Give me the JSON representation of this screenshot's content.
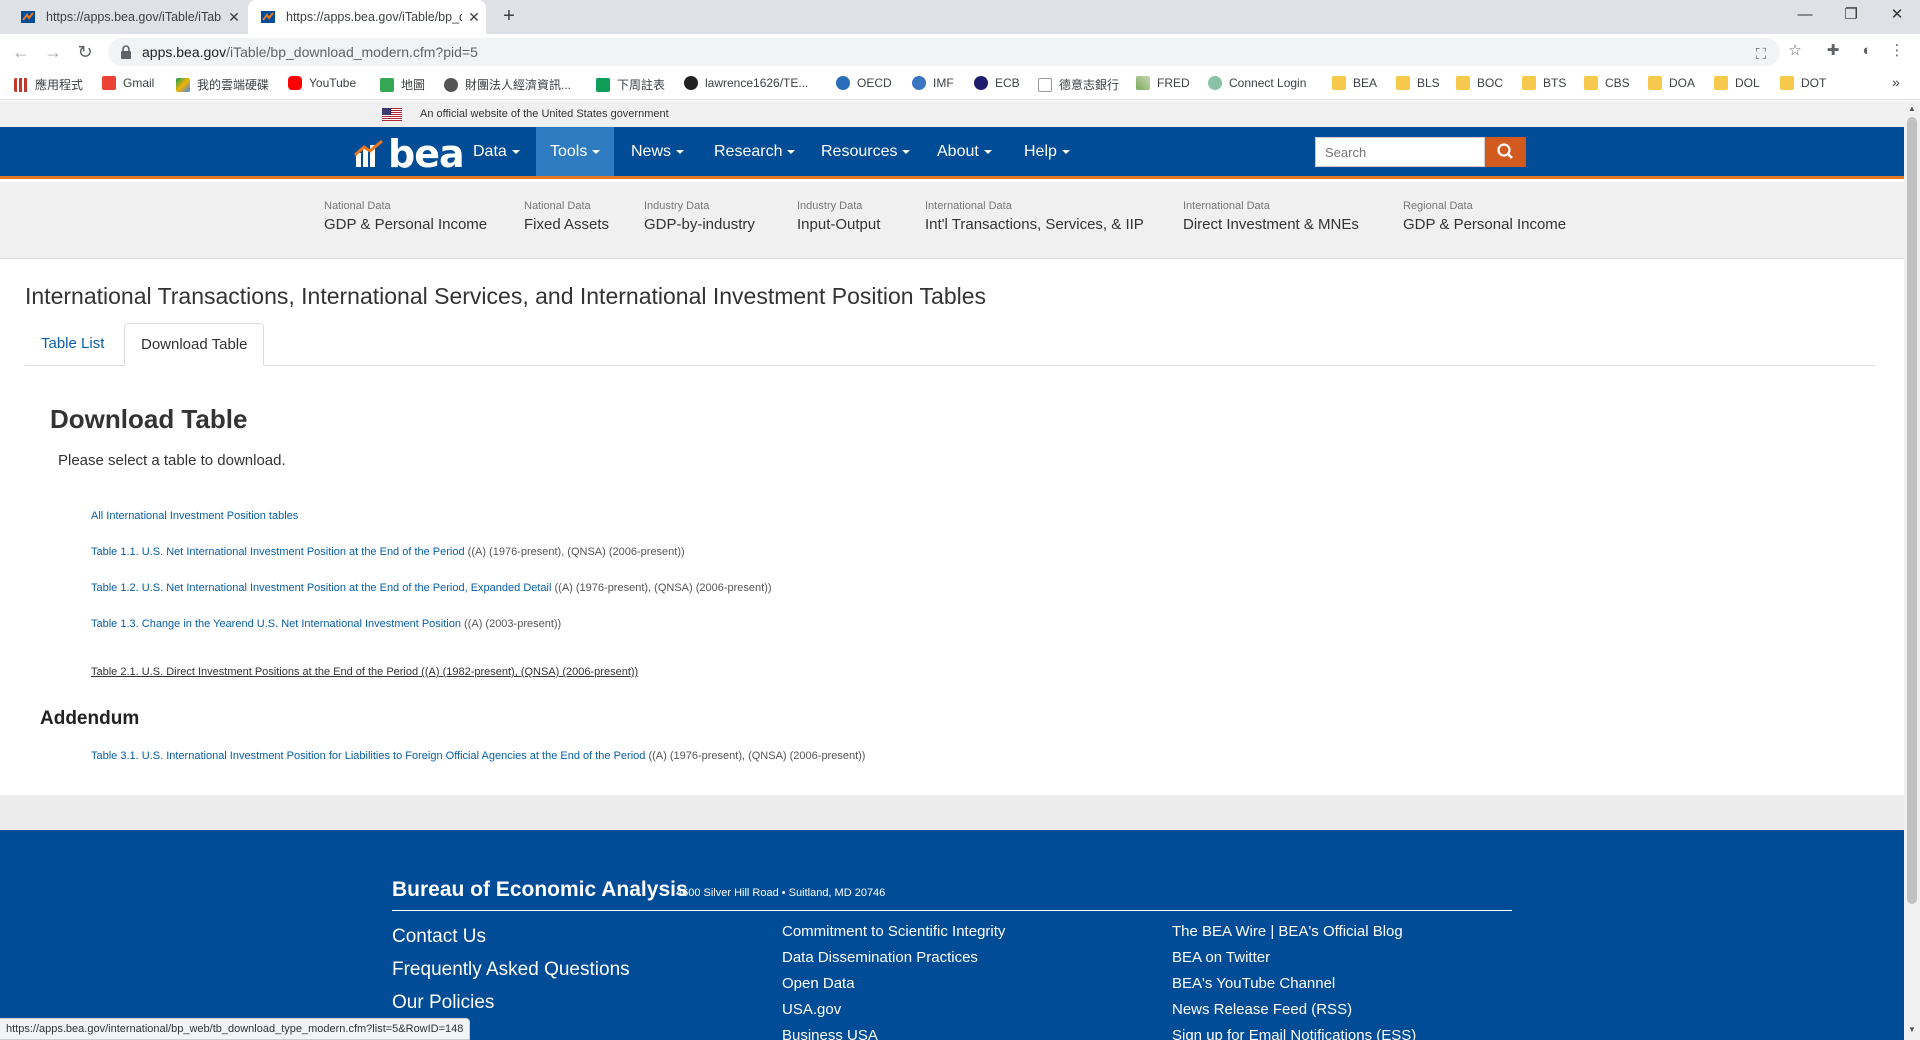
{
  "browser": {
    "tabs": [
      {
        "title": "https://apps.bea.gov/iTable/iTable.cfm"
      },
      {
        "title": "https://apps.bea.gov/iTable/bp_download_modern.cfm"
      }
    ],
    "url_host": "apps.bea.gov",
    "url_path": "/iTable/bp_download_modern.cfm?pid=5",
    "bookmarks": [
      "應用程式",
      "Gmail",
      "我的雲端硬碟",
      "YouTube",
      "地圖",
      "財團法人經濟資訊...",
      "下周註表",
      "lawrence1626/TE...",
      "OECD",
      "IMF",
      "ECB",
      "德意志銀行",
      "FRED",
      "Connect Login",
      "BEA",
      "BLS",
      "BOC",
      "BTS",
      "CBS",
      "DOA",
      "DOL",
      "DOT"
    ],
    "bookmarks_more": "»",
    "status_url": "https://apps.bea.gov/international/bp_web/tb_download_type_modern.cfm?list=5&RowID=148"
  },
  "gov_banner": {
    "text": "An official website of the United States government"
  },
  "nav": {
    "logo_text": "bea",
    "items": [
      "Data",
      "Tools",
      "News",
      "Research",
      "Resources",
      "About",
      "Help"
    ],
    "active": "Tools",
    "search_placeholder": "Search"
  },
  "subnav": [
    {
      "kicker": "National Data",
      "label": "GDP & Personal Income"
    },
    {
      "kicker": "National Data",
      "label": "Fixed Assets"
    },
    {
      "kicker": "Industry Data",
      "label": "GDP-by-industry"
    },
    {
      "kicker": "Industry Data",
      "label": "Input-Output"
    },
    {
      "kicker": "International Data",
      "label": "Int'l Transactions, Services, & IIP"
    },
    {
      "kicker": "International Data",
      "label": "Direct Investment & MNEs"
    },
    {
      "kicker": "Regional Data",
      "label": "GDP & Personal Income"
    }
  ],
  "page": {
    "title": "International Transactions, International Services, and International Investment Position Tables",
    "tabs": [
      "Table List",
      "Download Table"
    ],
    "heading": "Download Table",
    "lead": "Please select a table to download.",
    "tables": [
      {
        "link": "All International Investment Position tables",
        "rest": ""
      },
      {
        "link": "Table 1.1. U.S. Net International Investment Position at the End of the Period",
        "rest": " ((A) (1976-present), (QNSA) (2006-present))"
      },
      {
        "link": "Table 1.2. U.S. Net International Investment Position at the End of the Period, Expanded Detail",
        "rest": " ((A) (1976-present), (QNSA) (2006-present))"
      },
      {
        "link": "Table 1.3. Change in the Yearend U.S. Net International Investment Position",
        "rest": " ((A) (2003-present))"
      },
      {
        "link": "Table 2.1. U.S. Direct Investment Positions at the End of the Period",
        "rest": " ((A) (1982-present), (QNSA) (2006-present))"
      }
    ],
    "addendum_heading": "Addendum",
    "addendum_tables": [
      {
        "link": "Table 3.1. U.S. International Investment Position for Liabilities to Foreign Official Agencies at the End of the Period",
        "rest": " ((A) (1976-present), (QNSA) (2006-present))"
      }
    ]
  },
  "footer": {
    "brand": "Bureau of Economic Analysis",
    "address": "4600 Silver Hill Road • Suitland, MD 20746",
    "col1": [
      "Contact Us",
      "Frequently Asked Questions",
      "Our Policies"
    ],
    "col2": [
      "Commitment to Scientific Integrity",
      "Data Dissemination Practices",
      "Open Data",
      "USA.gov",
      "Business USA"
    ],
    "col3": [
      "The BEA Wire | BEA's Official Blog",
      "BEA on Twitter",
      "BEA's YouTube Channel",
      "News Release Feed (RSS)",
      "Sign up for Email Notifications (ESS)"
    ]
  },
  "colors": {
    "nav_blue": "#004c97",
    "accent_orange": "#e87722",
    "search_button": "#d35a1e",
    "link_blue": "#0a5ea8"
  }
}
